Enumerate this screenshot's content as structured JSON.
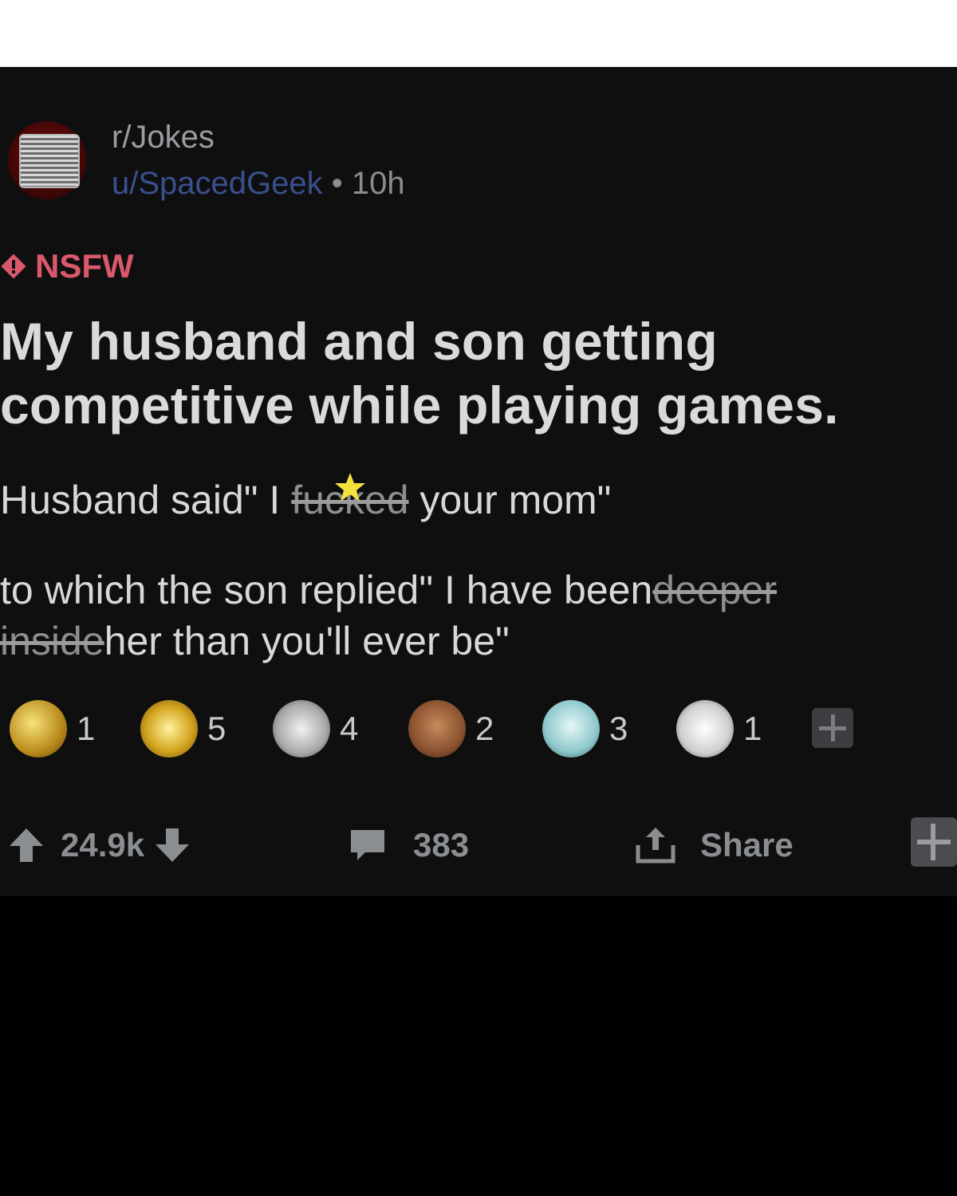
{
  "post": {
    "subreddit": "r/Jokes",
    "author": "u/SpacedGeek",
    "separator": "•",
    "age": "10h",
    "flair": "NSFW",
    "title": "My husband and son getting competitive while playing games.",
    "line1": {
      "before": "Husband said\" I ",
      "struck": "fucked",
      "after": " your mom\""
    },
    "line2": {
      "before": "to which the son replied\" I have been",
      "struck": "deeper inside",
      "after": "her than you'll ever be\""
    }
  },
  "awards": [
    {
      "icon": "gold-dragon-award-icon",
      "count": "1"
    },
    {
      "icon": "golden-lion-award-icon",
      "count": "5"
    },
    {
      "icon": "applause-hands-award-icon",
      "count": "4"
    },
    {
      "icon": "sloth-award-icon",
      "count": "2"
    },
    {
      "icon": "angel-award-icon",
      "count": "3"
    },
    {
      "icon": "snoo-laugh-award-icon",
      "count": "1"
    }
  ],
  "actions": {
    "votes": "24.9k",
    "comments": "383",
    "share": "Share"
  },
  "colors": {
    "background": "#0f0f10",
    "username": "#3a4f8e",
    "nsfw": "#d9596b",
    "star": "#f5e13c"
  }
}
